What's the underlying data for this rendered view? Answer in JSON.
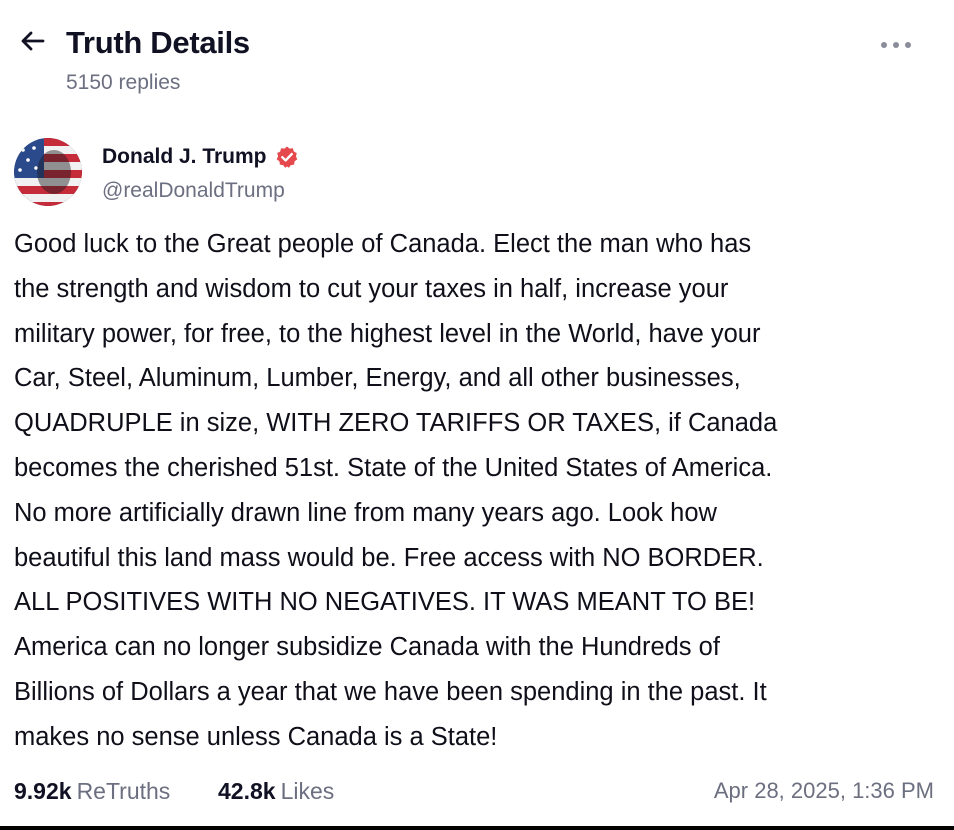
{
  "header": {
    "title": "Truth Details",
    "replies": "5150 replies",
    "back_icon": "arrow-left-icon",
    "more_icon": "more-horizontal-icon"
  },
  "author": {
    "name": "Donald J. Trump",
    "handle": "@realDonaldTrump",
    "verified_icon": "verified-badge-icon",
    "verified_color": "#e5484d"
  },
  "post": {
    "text": "Good luck to the Great people of Canada. Elect the man who has\nthe strength and wisdom to cut your taxes in half, increase your\nmilitary power, for free, to the highest level in the World, have your\nCar, Steel, Aluminum, Lumber, Energy, and all other businesses,\nQUADRUPLE in size, WITH ZERO TARIFFS OR TAXES, if Canada\nbecomes the cherished 51st. State of the United States of America.\nNo more artificially drawn line from many years ago. Look how\nbeautiful this land mass would be. Free access with NO BORDER.\nALL POSITIVES WITH NO NEGATIVES. IT WAS MEANT TO BE!\nAmerica can no longer subsidize Canada with the Hundreds of\nBillions of Dollars a year that we have been spending in the past. It\nmakes no sense unless Canada is a State!"
  },
  "stats": {
    "retruths_count": "9.92k",
    "retruths_label": "ReTruths",
    "likes_count": "42.8k",
    "likes_label": "Likes",
    "timestamp": "Apr 28, 2025, 1:36 PM"
  }
}
